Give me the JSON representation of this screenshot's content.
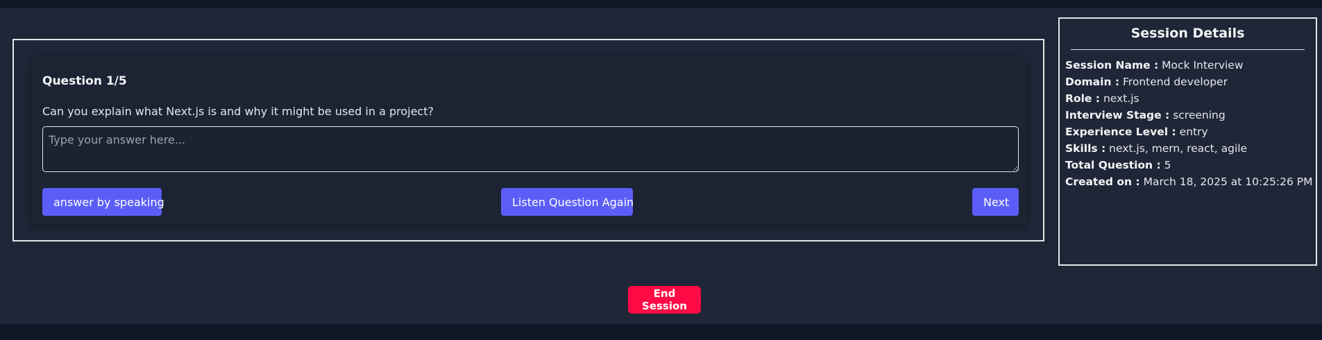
{
  "question": {
    "title": "Question 1/5",
    "text": "Can you explain what Next.js is and why it might be used in a project?",
    "answer_value": "",
    "answer_placeholder": "Type your answer here...",
    "buttons": {
      "speak_label": "answer by speaking",
      "listen_label": "Listen Question Again",
      "next_label": "Next"
    }
  },
  "session": {
    "title": "Session Details",
    "details": [
      {
        "label": "Session Name :",
        "value": "Mock Interview"
      },
      {
        "label": "Domain :",
        "value": "Frontend developer"
      },
      {
        "label": "Role :",
        "value": "next.js"
      },
      {
        "label": "Interview Stage :",
        "value": "screening"
      },
      {
        "label": "Experience Level :",
        "value": "entry"
      },
      {
        "label": "Skills :",
        "value": "next.js, mern, react, agile"
      },
      {
        "label": "Total Question :",
        "value": "5"
      },
      {
        "label": "Created on :",
        "value": "March 18, 2025 at 10:25:26 PM"
      }
    ]
  },
  "end_session_label": "End Session",
  "colors": {
    "primary_button": "#5b5ef6",
    "danger_button": "#ff0a45",
    "background": "#1f2637"
  }
}
